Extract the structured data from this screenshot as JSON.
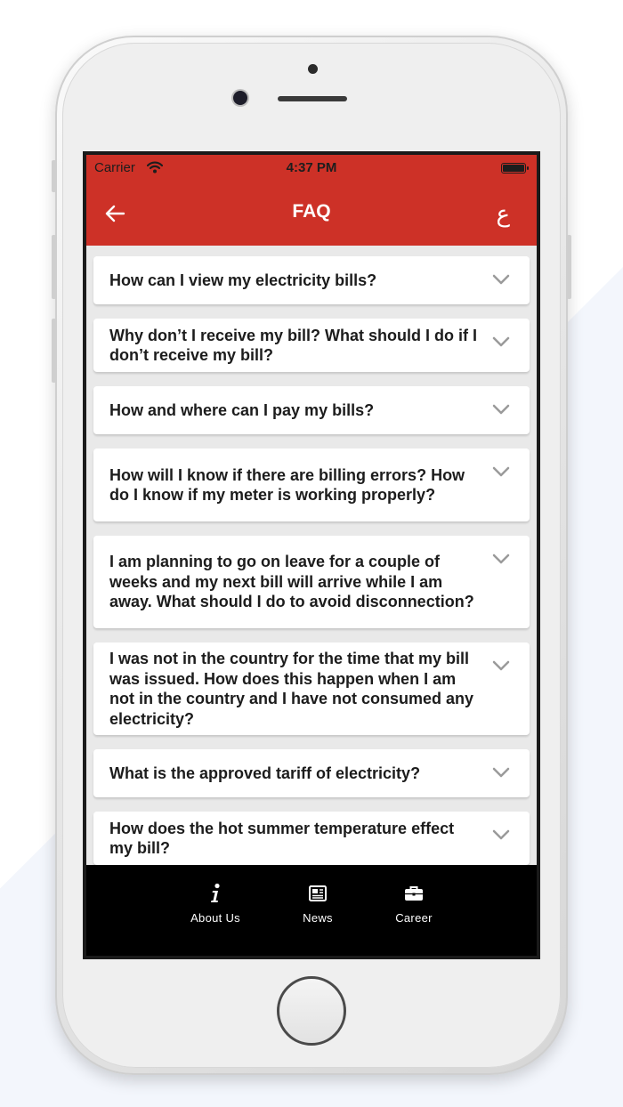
{
  "status_bar": {
    "carrier": "Carrier",
    "time": "4:37 PM"
  },
  "header": {
    "title": "FAQ",
    "language_toggle": "ع"
  },
  "faq": [
    {
      "question": "How can I view my electricity bills?"
    },
    {
      "question": "Why don’t I receive my bill? What should I do if I don’t receive my bill?"
    },
    {
      "question": "How and where can I pay my bills?"
    },
    {
      "question": "How will I know if there are billing errors? How do I know if my meter is working properly?"
    },
    {
      "question": "I am planning to go on leave for a couple of weeks and my next bill will arrive while I am away. What should I do to avoid disconnection?"
    },
    {
      "question": "I was not in the country for the time that my bill was issued. How does this happen when I am not in the country and I have not consumed any electricity?"
    },
    {
      "question": "What is the approved tariff of electricity?"
    },
    {
      "question": "How does the hot summer temperature effect my bill?"
    }
  ],
  "bottom_nav": [
    {
      "label": "About Us",
      "icon": "info-icon"
    },
    {
      "label": "News",
      "icon": "newspaper-icon"
    },
    {
      "label": "Career",
      "icon": "briefcase-icon"
    }
  ],
  "colors": {
    "header": "#cd3127",
    "nav": "#000000",
    "card": "#ffffff"
  }
}
